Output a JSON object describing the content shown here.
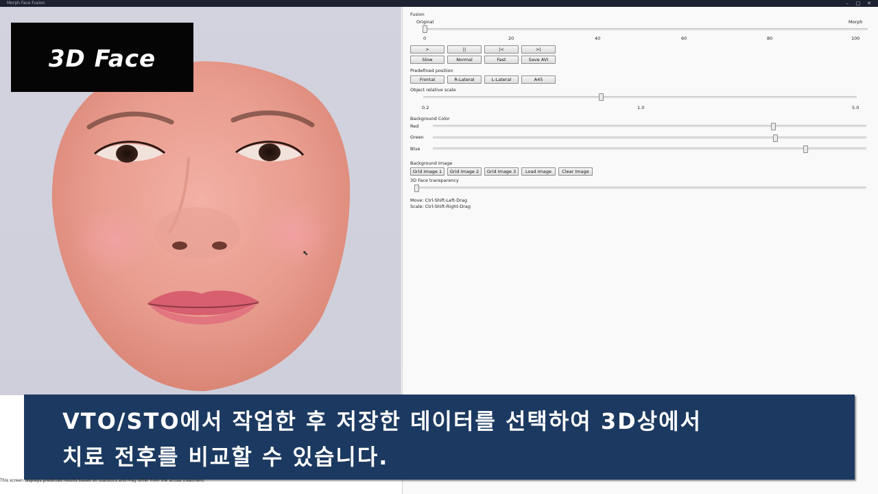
{
  "window": {
    "title": "Morph Face Fusion"
  },
  "overlay": {
    "label": "3D Face"
  },
  "fusion": {
    "section_label": "Fusion",
    "left_label": "Original",
    "right_label": "Morph",
    "ticks": [
      "0",
      "20",
      "40",
      "60",
      "80",
      "100"
    ],
    "value": 0
  },
  "playback": {
    "play": ">",
    "pause": "||",
    "to_start": "|<",
    "to_end": ">|",
    "slow": "Slow",
    "normal": "Normal",
    "fast": "Fast",
    "save_avi": "Save AVI"
  },
  "predefined": {
    "section_label": "Predefined position",
    "frontal": "Frontal",
    "r_lateral": "R-Lateral",
    "l_lateral": "L-Lateral",
    "a45": "A45"
  },
  "scale": {
    "section_label": "Object relative scale",
    "ticks": [
      "0.2",
      "1.0",
      "5.0"
    ],
    "value": 1.0
  },
  "background_color": {
    "section_label": "Background Color",
    "red_label": "Red",
    "green_label": "Green",
    "blue_label": "Blue",
    "red": 0.78,
    "green": 0.78,
    "blue": 0.86
  },
  "background_image": {
    "section_label": "Background Image",
    "grid1": "Grid Image 1",
    "grid2": "Grid Image 2",
    "grid3": "Grid Image 3",
    "load": "Load Image",
    "clear": "Clear Image"
  },
  "transparency": {
    "label": "3D Face transparency",
    "value": 0
  },
  "help": {
    "move": "Move: Ctrl-Shift-Left-Drag",
    "scale": "Scale: Ctrl-Shift-Right-Drag"
  },
  "caption": {
    "line1": "VTO/STO에서 작업한 후 저장한 데이터를 선택하여 3D상에서",
    "line2": "치료 전후를 비교할 수 있습니다."
  },
  "disclaimer": "This screen displays predicted results based on statistics and may differ from the actual treatment."
}
